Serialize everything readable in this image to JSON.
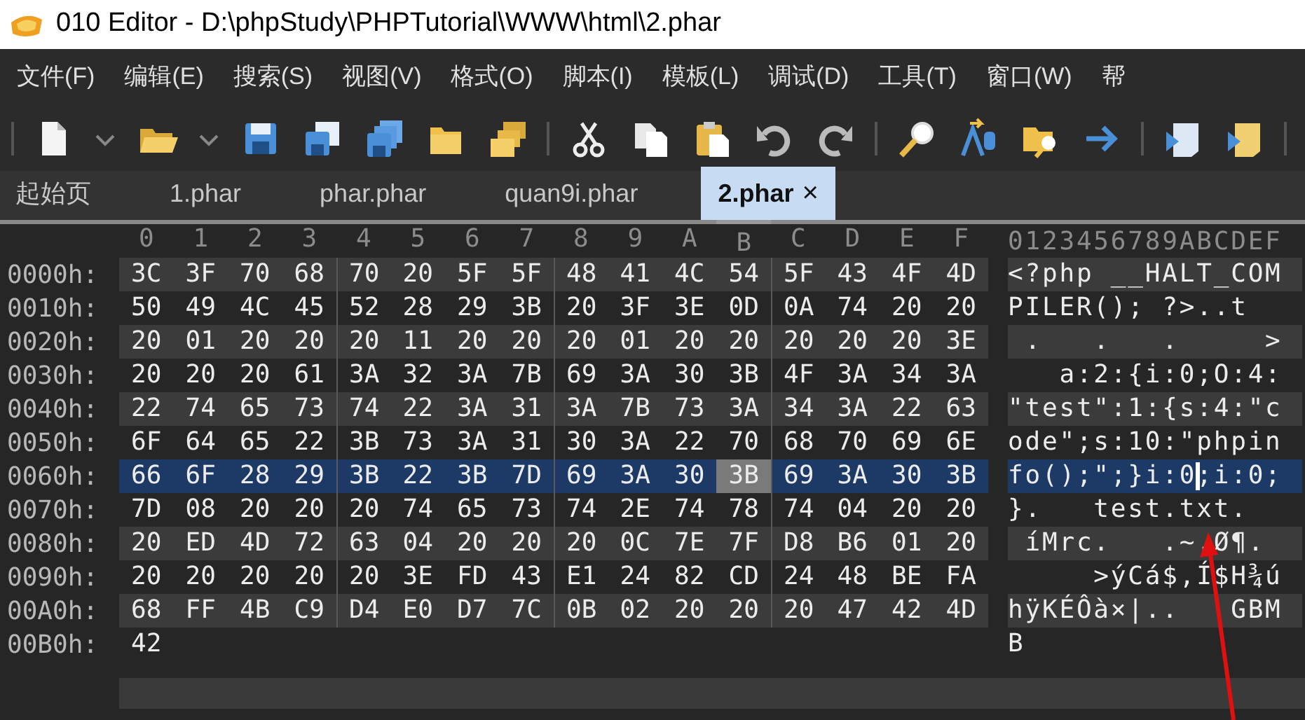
{
  "window": {
    "title": "010 Editor - D:\\phpStudy\\PHPTutorial\\WWW\\html\\2.phar"
  },
  "menu": [
    "文件(F)",
    "编辑(E)",
    "搜索(S)",
    "视图(V)",
    "格式(O)",
    "脚本(I)",
    "模板(L)",
    "调试(D)",
    "工具(T)",
    "窗口(W)",
    "帮"
  ],
  "tabs": [
    {
      "label": "起始页",
      "selected": false
    },
    {
      "label": "1.phar",
      "selected": false
    },
    {
      "label": "phar.phar",
      "selected": false
    },
    {
      "label": "quan9i.phar",
      "selected": false
    },
    {
      "label": "2.phar",
      "selected": true,
      "close": "×"
    }
  ],
  "hex_view": {
    "columns": [
      {
        "label": "0",
        "cursor": false
      },
      {
        "label": "1",
        "cursor": false
      },
      {
        "label": "2",
        "cursor": false
      },
      {
        "label": "3",
        "cursor": false
      },
      {
        "label": "4",
        "cursor": false
      },
      {
        "label": "5",
        "cursor": false
      },
      {
        "label": "6",
        "cursor": false
      },
      {
        "label": "7",
        "cursor": false
      },
      {
        "label": "8",
        "cursor": false
      },
      {
        "label": "9",
        "cursor": false
      },
      {
        "label": "A",
        "cursor": false
      },
      {
        "label": "B",
        "cursor": true
      },
      {
        "label": "C",
        "cursor": false
      },
      {
        "label": "D",
        "cursor": false
      },
      {
        "label": "E",
        "cursor": false
      },
      {
        "label": "F",
        "cursor": false
      }
    ],
    "text_header": "0123456789ABCDEF",
    "rows": [
      {
        "address": "0000h:",
        "bytes": [
          "3C",
          "3F",
          "70",
          "68",
          "70",
          "20",
          "5F",
          "5F",
          "48",
          "41",
          "4C",
          "54",
          "5F",
          "43",
          "4F",
          "4D"
        ],
        "text": "<?php __HALT_COM",
        "selected": false,
        "cursor": false
      },
      {
        "address": "0010h:",
        "bytes": [
          "50",
          "49",
          "4C",
          "45",
          "52",
          "28",
          "29",
          "3B",
          "20",
          "3F",
          "3E",
          "0D",
          "0A",
          "74",
          "20",
          "20"
        ],
        "text": "PILER(); ?>..t",
        "selected": false,
        "cursor": false
      },
      {
        "address": "0020h:",
        "bytes": [
          "20",
          "01",
          "20",
          "20",
          "20",
          "11",
          "20",
          "20",
          "20",
          "01",
          "20",
          "20",
          "20",
          "20",
          "20",
          "3E"
        ],
        "text": " .   .   .     >",
        "selected": false,
        "cursor": false
      },
      {
        "address": "0030h:",
        "bytes": [
          "20",
          "20",
          "20",
          "61",
          "3A",
          "32",
          "3A",
          "7B",
          "69",
          "3A",
          "30",
          "3B",
          "4F",
          "3A",
          "34",
          "3A"
        ],
        "text": "   a:2:{i:0;O:4:",
        "selected": false,
        "cursor": false
      },
      {
        "address": "0040h:",
        "bytes": [
          "22",
          "74",
          "65",
          "73",
          "74",
          "22",
          "3A",
          "31",
          "3A",
          "7B",
          "73",
          "3A",
          "34",
          "3A",
          "22",
          "63"
        ],
        "text": "\"test\":1:{s:4:\"c",
        "selected": false,
        "cursor": false
      },
      {
        "address": "0050h:",
        "bytes": [
          "6F",
          "64",
          "65",
          "22",
          "3B",
          "73",
          "3A",
          "31",
          "30",
          "3A",
          "22",
          "70",
          "68",
          "70",
          "69",
          "6E"
        ],
        "text": "ode\";s:10:\"phpin",
        "selected": false,
        "cursor": false
      },
      {
        "address": "0060h:",
        "bytes": [
          "66",
          "6F",
          "28",
          "29",
          "3B",
          "22",
          "3B",
          "7D",
          "69",
          "3A",
          "30",
          "3B",
          "69",
          "3A",
          "30",
          "3B"
        ],
        "text": "fo();\";}i:0;i:0;",
        "selected": true,
        "cursor": true
      },
      {
        "address": "0070h:",
        "bytes": [
          "7D",
          "08",
          "20",
          "20",
          "20",
          "74",
          "65",
          "73",
          "74",
          "2E",
          "74",
          "78",
          "74",
          "04",
          "20",
          "20"
        ],
        "text": "}.   test.txt.",
        "selected": false,
        "cursor": false
      },
      {
        "address": "0080h:",
        "bytes": [
          "20",
          "ED",
          "4D",
          "72",
          "63",
          "04",
          "20",
          "20",
          "20",
          "0C",
          "7E",
          "7F",
          "D8",
          "B6",
          "01",
          "20"
        ],
        "text": " íMrc.   .~.Ø¶.",
        "selected": false,
        "cursor": false
      },
      {
        "address": "0090h:",
        "bytes": [
          "20",
          "20",
          "20",
          "20",
          "20",
          "3E",
          "FD",
          "43",
          "E1",
          "24",
          "82",
          "CD",
          "24",
          "48",
          "BE",
          "FA"
        ],
        "text": "     >ýCá$,Í$H¾ú",
        "selected": false,
        "cursor": false
      },
      {
        "address": "00A0h:",
        "bytes": [
          "68",
          "FF",
          "4B",
          "C9",
          "D4",
          "E0",
          "D7",
          "7C",
          "0B",
          "02",
          "20",
          "20",
          "20",
          "47",
          "42",
          "4D"
        ],
        "text": "hÿKÉÔà×|..   GBM",
        "selected": false,
        "cursor": false
      },
      {
        "address": "00B0h:",
        "bytes": [
          "42"
        ],
        "text": "B",
        "selected": false,
        "cursor": false
      }
    ]
  }
}
